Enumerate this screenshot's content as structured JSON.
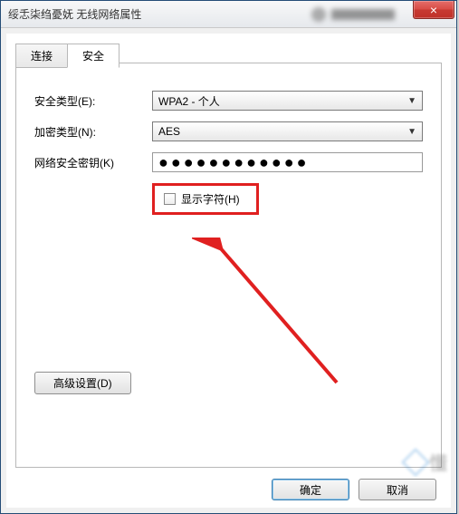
{
  "window": {
    "title": "绥忎柒绉憂妩 无线网络属性",
    "close_label": "×"
  },
  "tabs": {
    "connect": "连接",
    "security": "安全"
  },
  "form": {
    "security_type_label": "安全类型(E):",
    "security_type_value": "WPA2 - 个人",
    "encryption_label": "加密类型(N):",
    "encryption_value": "AES",
    "key_label": "网络安全密钥(K)",
    "key_value": "●●●●●●●●●●●●",
    "show_chars_label": "显示字符(H)"
  },
  "advanced_button": "高级设置(D)",
  "buttons": {
    "ok": "确定",
    "cancel": "取消"
  }
}
